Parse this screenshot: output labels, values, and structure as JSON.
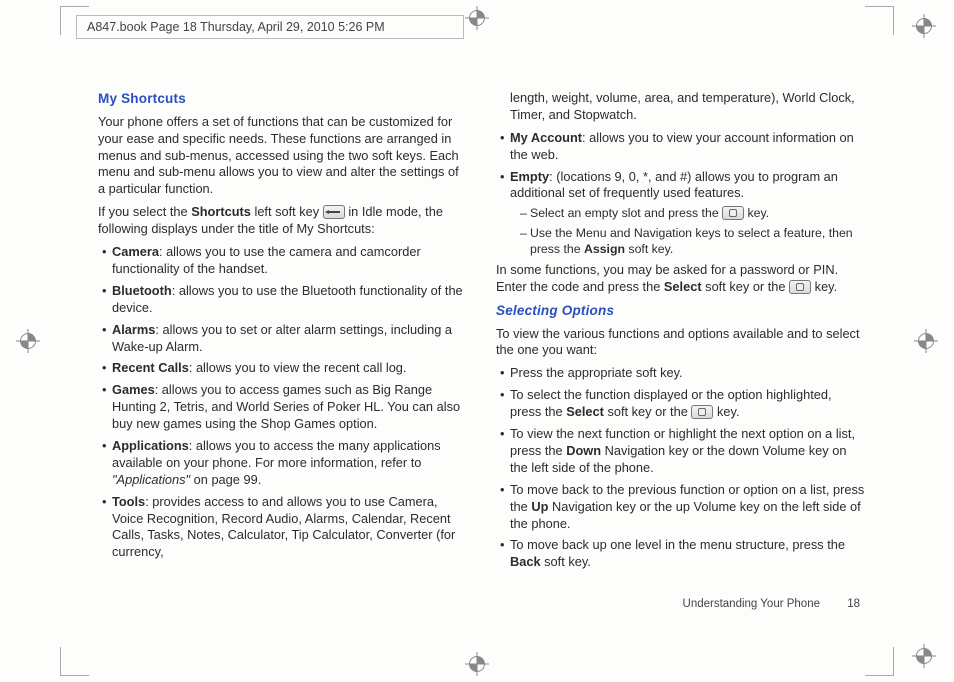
{
  "header": {
    "text": "A847.book  Page 18  Thursday, April 29, 2010  5:26 PM"
  },
  "left": {
    "h_myshortcuts": "My Shortcuts",
    "intro1": "Your phone offers a set of functions that can be customized for your ease and specific needs. These functions are arranged in menus and sub-menus, accessed using the two soft keys. Each menu and sub-menu allows you to view and alter the settings of a particular function.",
    "intro2a": "If you select the ",
    "intro2b": "Shortcuts",
    "intro2c": " left soft key ",
    "intro2d": " in Idle mode, the following displays under the title of My Shortcuts:",
    "camera_b": "Camera",
    "camera_t": ": allows you to use the camera and camcorder functionality of the handset.",
    "bluetooth_b": "Bluetooth",
    "bluetooth_t": ": allows you to use the Bluetooth functionality of the device.",
    "alarms_b": "Alarms",
    "alarms_t": ": allows you to set or alter alarm settings, including a Wake-up Alarm.",
    "recent_b": "Recent Calls",
    "recent_t": ": allows you to view the recent call log.",
    "games_b": "Games",
    "games_t": ": allows you to access games such as Big Range Hunting 2, Tetris, and World Series of Poker HL. You can also buy new games using the Shop Games option.",
    "apps_b": "Applications",
    "apps_t1": ": allows you to access the many applications available on your phone. For more information, refer to ",
    "apps_ref": "\"Applications\"",
    "apps_t2": "  on page 99.",
    "tools_b": "Tools",
    "tools_t": ": provides access to and allows you to use Camera, Voice Recognition, Record Audio, Alarms, Calendar, Recent Calls, Tasks, Notes, Calculator, Tip Calculator, Converter (for currency,"
  },
  "right": {
    "tools_cont": "length, weight, volume, area, and temperature), World Clock, Timer, and Stopwatch.",
    "myacct_b": "My Account",
    "myacct_t": ": allows you to view your account information on the web.",
    "empty_b": "Empty",
    "empty_t": ": (locations 9, 0, *, and #) allows you to program an additional set of frequently used features.",
    "empty_s1a": "Select an empty slot and press the ",
    "empty_s1b": " key.",
    "empty_s2a": "Use the Menu and Navigation keys to select a feature, then press the ",
    "empty_s2b": "Assign",
    "empty_s2c": " soft key.",
    "pin1": "In some functions, you may be asked for a password or PIN. Enter the code and press the ",
    "pin_b": "Select",
    "pin2": " soft key or the ",
    "pin3": " key.",
    "h_selecting": "Selecting Options",
    "sel_intro": "To view the various functions and options available and to select the one you want:",
    "sel1": "Press the appropriate soft key.",
    "sel2a": "To select the function displayed or the option highlighted, press the ",
    "sel2b": "Select",
    "sel2c": " soft key or the ",
    "sel2d": " key.",
    "sel3a": "To view the next function or highlight the next option on a list, press the ",
    "sel3b": "Down",
    "sel3c": " Navigation key or the down Volume key on the left side of the phone.",
    "sel4a": "To move back to the previous function or option on a list, press the ",
    "sel4b": "Up",
    "sel4c": " Navigation key or the up Volume key on the left side of the phone.",
    "sel5a": "To move back up one level in the menu structure, press the ",
    "sel5b": "Back",
    "sel5c": " soft key."
  },
  "footer": {
    "section": "Understanding Your Phone",
    "page": "18"
  }
}
